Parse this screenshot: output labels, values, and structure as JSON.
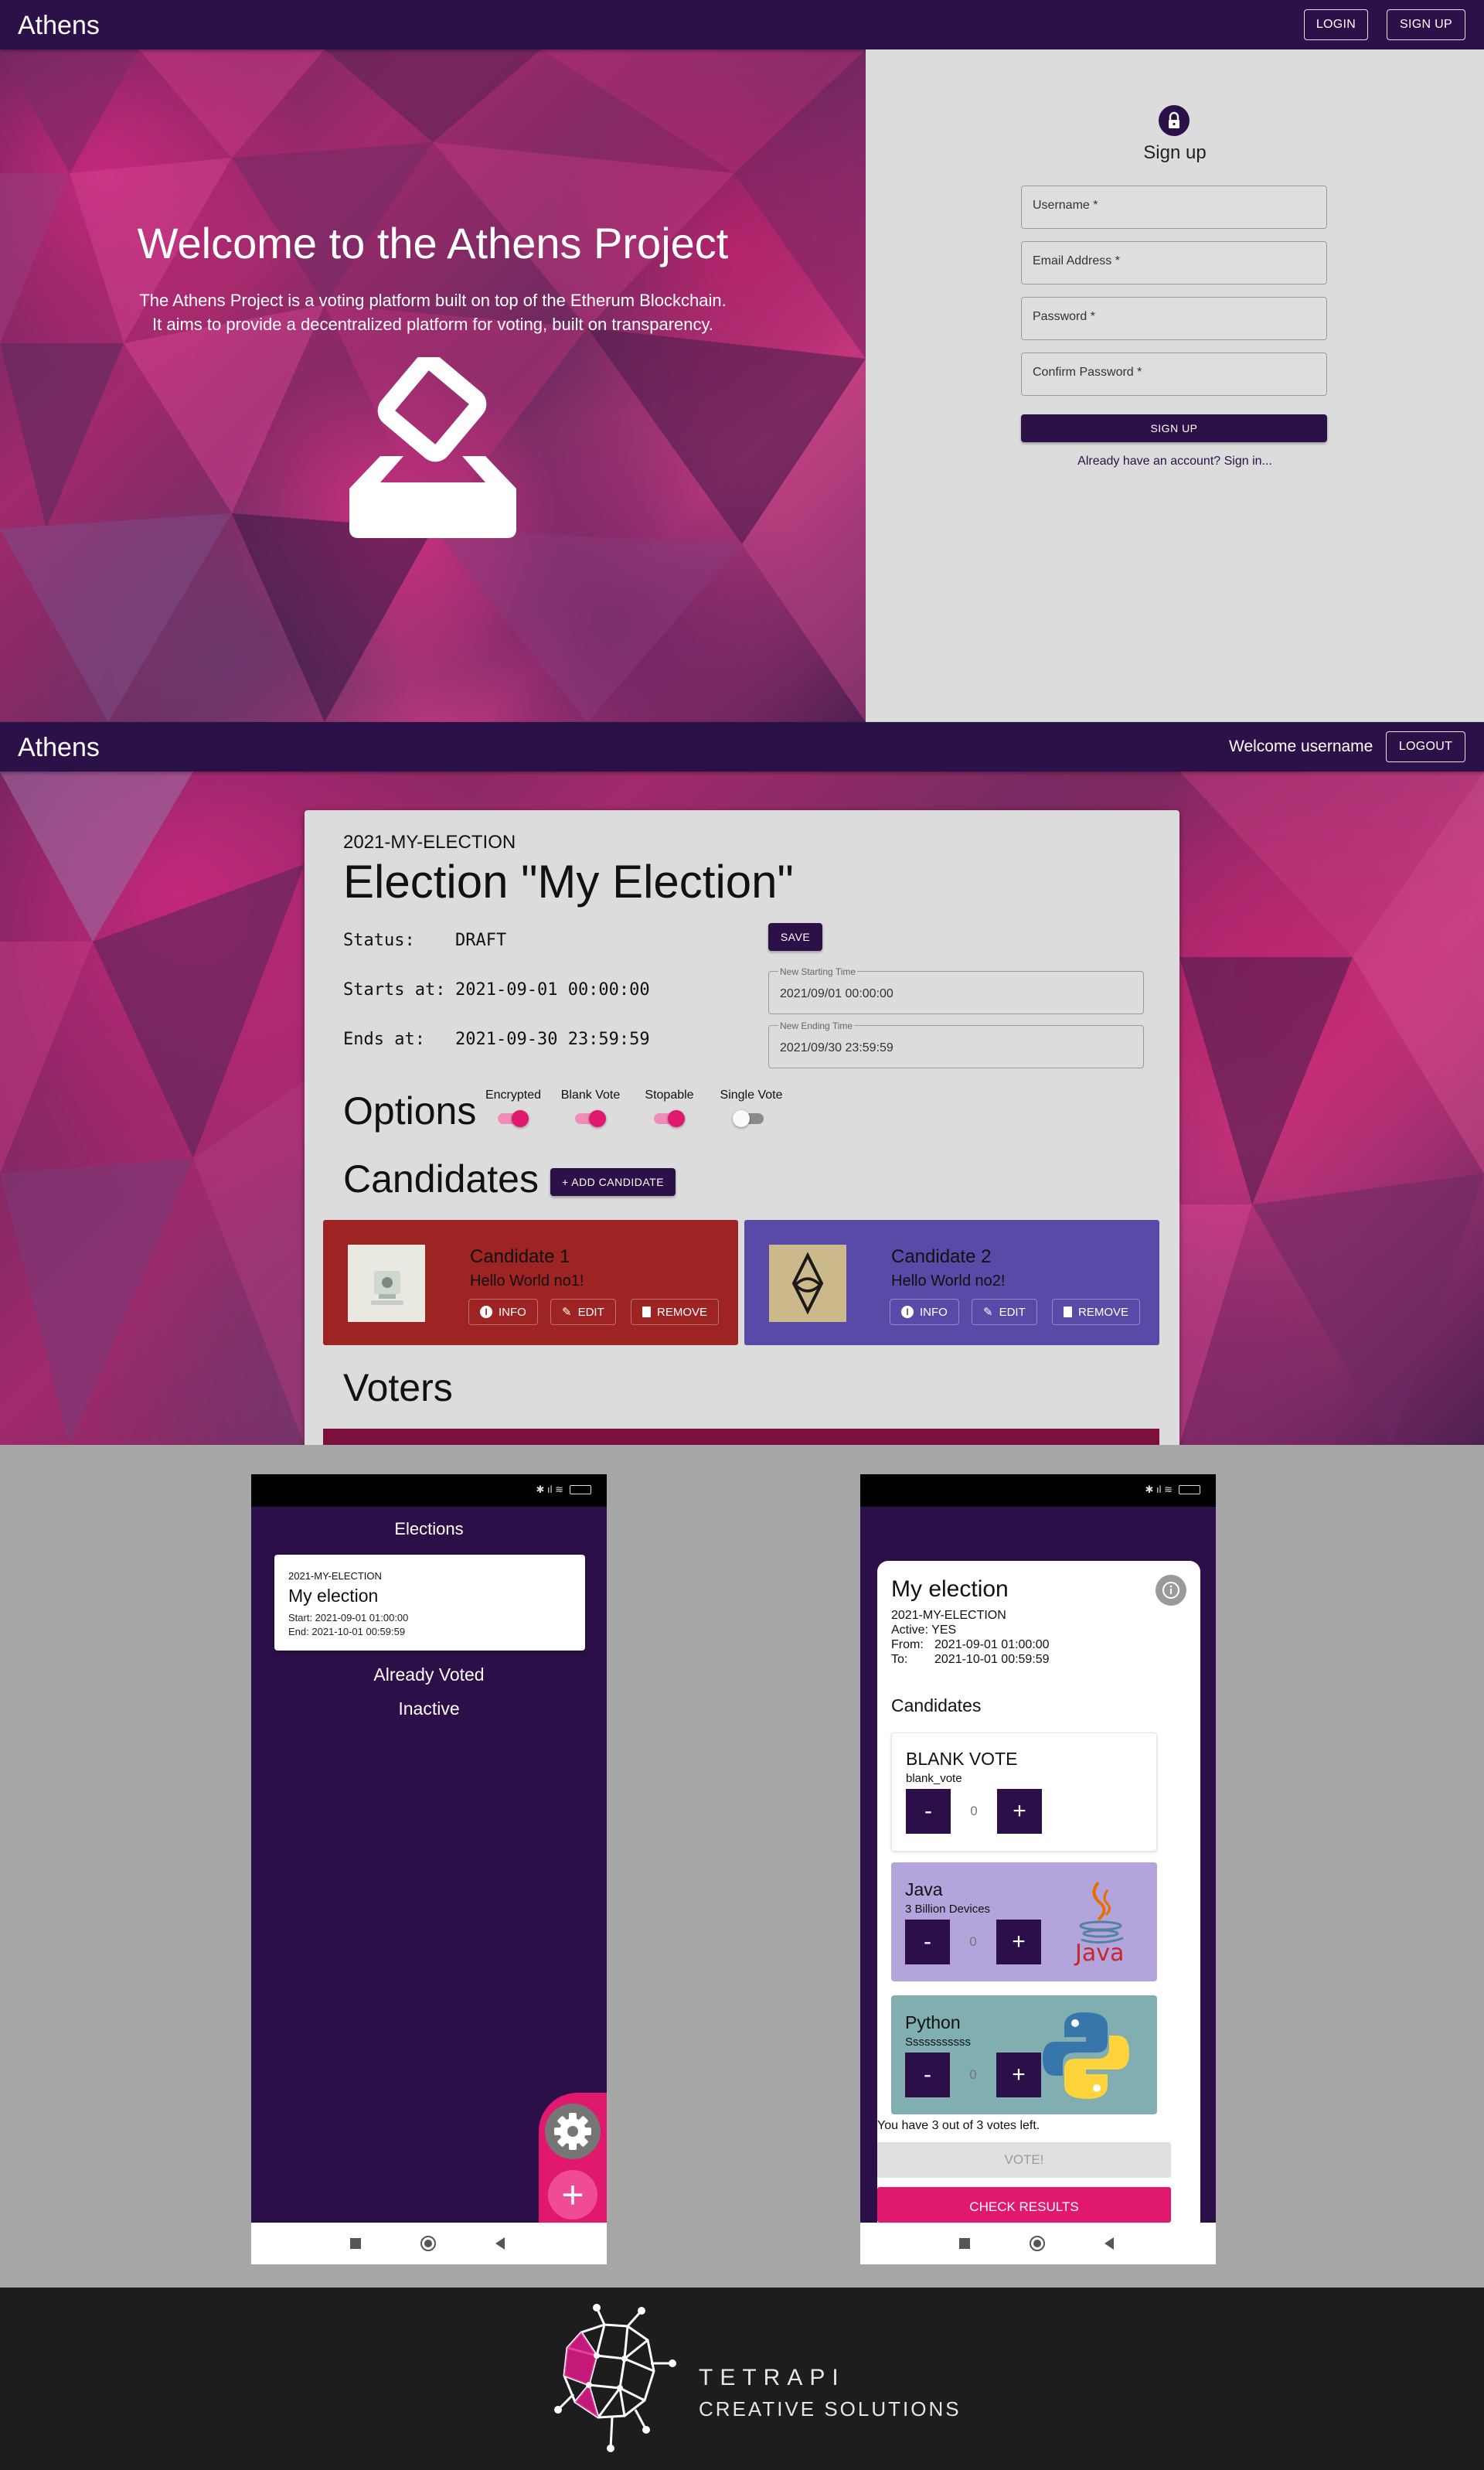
{
  "section1": {
    "brand": "Athens",
    "login_label": "LOGIN",
    "signup_label": "SIGN UP",
    "hero_title": "Welcome to the Athens Project",
    "hero_line1": "The Athens Project is a voting platform built on top of the Etherum Blockchain.",
    "hero_line2": "It aims to provide a decentralized platform for voting, built on transparency.",
    "form": {
      "title": "Sign up",
      "username": "Username *",
      "email": "Email Address *",
      "password": "Password *",
      "confirm_password": "Confirm Password *",
      "submit": "SIGN UP",
      "signin_link": "Already have an account? Sign in..."
    }
  },
  "section2": {
    "brand": "Athens",
    "welcome": "Welcome username",
    "logout_label": "LOGOUT",
    "election_id": "2021-MY-ELECTION",
    "election_title": "Election \"My Election\"",
    "status_label": "Status:",
    "status_value": "DRAFT",
    "starts_label": "Starts at:",
    "starts_value": "2021-09-01 00:00:00",
    "ends_label": "Ends at:",
    "ends_value": "2021-09-30 23:59:59",
    "save_label": "SAVE",
    "new_start_label": "New Starting Time",
    "new_start_value": "2021/09/01 00:00:00",
    "new_end_label": "New Ending Time",
    "new_end_value": "2021/09/30 23:59:59",
    "options_heading": "Options",
    "options": [
      {
        "label": "Encrypted",
        "on": true
      },
      {
        "label": "Blank Vote",
        "on": true
      },
      {
        "label": "Stopable",
        "on": true
      },
      {
        "label": "Single Vote",
        "on": false
      }
    ],
    "candidates_heading": "Candidates",
    "add_candidate_label": "+ ADD CANDIDATE",
    "candidates": [
      {
        "name": "Candidate 1",
        "desc": "Hello World no1!",
        "color": "#9e2323"
      },
      {
        "name": "Candidate 2",
        "desc": "Hello World no2!",
        "color": "#5a4aa8"
      }
    ],
    "info_label": "INFO",
    "edit_label": "EDIT",
    "remove_label": "REMOVE",
    "voters_heading": "Voters"
  },
  "phone1": {
    "title": "Elections",
    "card_id": "2021-MY-ELECTION",
    "card_title": "My election",
    "card_start": "Start: 2021-09-01 01:00:00",
    "card_end": "End: 2021-10-01 00:59:59",
    "already_voted": "Already Voted",
    "inactive": "Inactive"
  },
  "phone2": {
    "title": "My election",
    "id": "2021-MY-ELECTION",
    "active": "Active: YES",
    "from_label": "From:",
    "from_value": "2021-09-01 01:00:00",
    "to_label": "To:",
    "to_value": "2021-10-01 00:59:59",
    "candidates_heading": "Candidates",
    "candidates": [
      {
        "name": "BLANK VOTE",
        "desc": "blank_vote",
        "value": "0",
        "color": "#ffffff"
      },
      {
        "name": "Java",
        "desc": "3 Billion Devices",
        "value": "0",
        "color": "#b3a4dc"
      },
      {
        "name": "Python",
        "desc": "Sssssssssss",
        "value": "0",
        "color": "#80aeb1"
      }
    ],
    "minus": "-",
    "plus": "+",
    "java_logo_text": "Java",
    "votes_left": "You have 3 out of 3 votes left.",
    "vote_button": "VOTE!",
    "results_button": "CHECK RESULTS"
  },
  "footer": {
    "company_line1": "TETRAPI",
    "company_line2": "CREATIVE SOLUTIONS"
  },
  "colors": {
    "primary": "#2c1149",
    "accent": "#e0196f",
    "panel": "#dcdcdc"
  }
}
